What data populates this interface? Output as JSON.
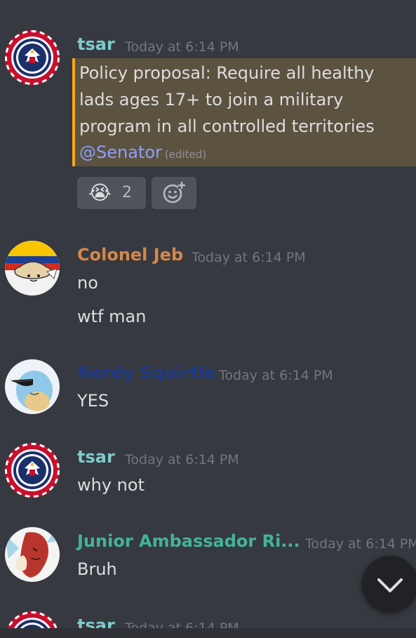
{
  "messages": [
    {
      "username": "tsar",
      "timestamp": "Today at 6:14 PM",
      "lines": [
        "Policy proposal: Require all healthy",
        "lads ages 17+ to join a military",
        "program in all controlled territories"
      ],
      "mention": "@Senator",
      "edited": "(edited)",
      "reactions": [
        {
          "emoji": "😭",
          "count": "2"
        },
        {
          "icon": "add-reaction-icon"
        }
      ]
    },
    {
      "username": "Colonel Jeb",
      "timestamp": "Today at 6:14 PM",
      "lines": [
        "no",
        "wtf man"
      ]
    },
    {
      "username": "Nerdy Squirtle",
      "timestamp": "Today at 6:14 PM",
      "lines": [
        "YES"
      ]
    },
    {
      "username": "tsar",
      "timestamp": "Today at 6:14 PM",
      "lines": [
        "why not"
      ]
    },
    {
      "username": "Junior Ambassador Ri...",
      "timestamp": "Today at 6:14 PM",
      "lines": [
        "Bruh"
      ]
    },
    {
      "username": "tsar",
      "timestamp": "Today at 6:14 PM",
      "lines": []
    }
  ],
  "colors": {
    "background": "#36393f",
    "tsar": "#7ecbcb",
    "colonel_jeb": "#d4884a",
    "nerdy_squirtle": "#1f3a8a",
    "junior_ambassador": "#43b39a",
    "mention_highlight": "#5c5240",
    "mention_bar": "#faa61a",
    "timestamp": "#72767d"
  },
  "scroll_button": {
    "icon": "chevron-down-icon"
  }
}
